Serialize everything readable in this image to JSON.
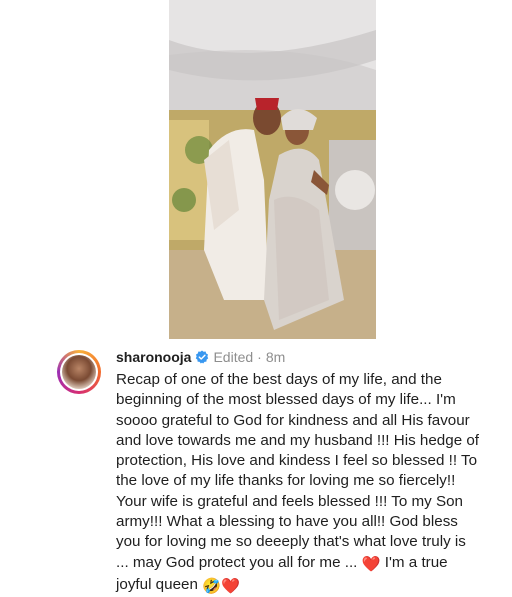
{
  "post": {
    "media": {
      "icon": "wedding-photo"
    },
    "comment": {
      "username": "sharonooja",
      "verified_icon": "verified-badge-icon",
      "edited_label": "Edited",
      "separator": "·",
      "time": "8m",
      "caption_lines": [
        "Recap of one of the best days of my life, and the",
        "beginning of the most blessed days of my life... I'm",
        "soooo grateful to God for kindness and all His favour",
        "and love towards me and my husband !!! His hedge of",
        "protection, His love and kindess I feel so blessed !! To",
        "the love of my life thanks for loving me so fiercely!!",
        "Your wife is grateful and feels blessed !!! To my Son",
        "army!!! What a blessing to have you all!! God bless",
        "you for loving me so deeeply that's what love truly is",
        "... may God protect you all for me ...",
        "I'm a true",
        "joyful queen"
      ],
      "emojis": {
        "heart": "❤️",
        "laugh": "🤣"
      }
    }
  }
}
